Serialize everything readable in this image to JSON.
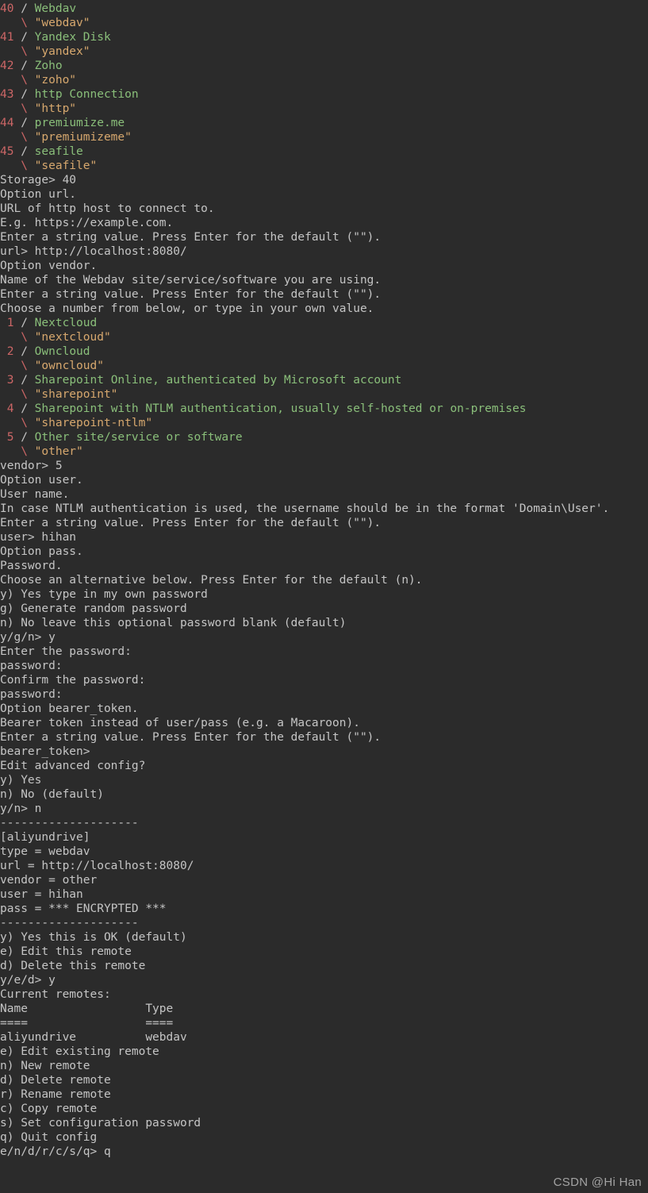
{
  "storage_options": [
    {
      "num": "40",
      "name": "Webdav",
      "code": "\"webdav\""
    },
    {
      "num": "41",
      "name": "Yandex Disk",
      "code": "\"yandex\""
    },
    {
      "num": "42",
      "name": "Zoho",
      "code": "\"zoho\""
    },
    {
      "num": "43",
      "name": "http Connection",
      "code": "\"http\""
    },
    {
      "num": "44",
      "name": "premiumize.me",
      "code": "\"premiumizeme\""
    },
    {
      "num": "45",
      "name": "seafile",
      "code": "\"seafile\""
    }
  ],
  "storage_prompt": "Storage> ",
  "storage_value": "40",
  "url_block": [
    "Option url.",
    "URL of http host to connect to.",
    "E.g. https://example.com.",
    "Enter a string value. Press Enter for the default (\"\")."
  ],
  "url_prompt": "url> ",
  "url_value": "http://localhost:8080/",
  "vendor_block": [
    "Option vendor.",
    "Name of the Webdav site/service/software you are using.",
    "Enter a string value. Press Enter for the default (\"\").",
    "Choose a number from below, or type in your own value."
  ],
  "vendor_options": [
    {
      "num": " 1",
      "name": "Nextcloud",
      "code": "\"nextcloud\""
    },
    {
      "num": " 2",
      "name": "Owncloud",
      "code": "\"owncloud\""
    },
    {
      "num": " 3",
      "name": "Sharepoint Online, authenticated by Microsoft account",
      "code": "\"sharepoint\""
    },
    {
      "num": " 4",
      "name": "Sharepoint with NTLM authentication, usually self-hosted or on-premises",
      "code": "\"sharepoint-ntlm\""
    },
    {
      "num": " 5",
      "name": "Other site/service or software",
      "code": "\"other\""
    }
  ],
  "vendor_prompt": "vendor> ",
  "vendor_value": "5",
  "user_block": [
    "Option user.",
    "User name.",
    "In case NTLM authentication is used, the username should be in the format 'Domain\\User'.",
    "Enter a string value. Press Enter for the default (\"\")."
  ],
  "user_prompt": "user> ",
  "user_value": "hihan",
  "pass_block": [
    "Option pass.",
    "Password.",
    "Choose an alternative below. Press Enter for the default (n).",
    "y) Yes type in my own password",
    "g) Generate random password",
    "n) No leave this optional password blank (default)"
  ],
  "pass_prompt": "y/g/n> ",
  "pass_value": "y",
  "password_lines": [
    "Enter the password:",
    "password:",
    "Confirm the password:",
    "password:"
  ],
  "bearer_block": [
    "Option bearer_token.",
    "Bearer token instead of user/pass (e.g. a Macaroon).",
    "Enter a string value. Press Enter for the default (\"\")."
  ],
  "bearer_prompt": "bearer_token>",
  "advanced_block": [
    "Edit advanced config?",
    "y) Yes",
    "n) No (default)"
  ],
  "advanced_prompt": "y/n> ",
  "advanced_value": "n",
  "sep": "--------------------",
  "config_header": "[aliyundrive]",
  "config_lines": [
    "type = webdav",
    "url = http://localhost:8080/",
    "vendor = other",
    "user = hihan",
    "pass = *** ENCRYPTED ***"
  ],
  "confirm_block": [
    "y) Yes this is OK (default)",
    "e) Edit this remote",
    "d) Delete this remote"
  ],
  "confirm_prompt": "y/e/d> ",
  "confirm_value": "y",
  "remotes_header": "Current remotes:",
  "remotes_cols": "Name                 Type",
  "remotes_sep": "====                 ====",
  "remotes_row": "aliyundrive          webdav",
  "menu_block": [
    "e) Edit existing remote",
    "n) New remote",
    "d) Delete remote",
    "r) Rename remote",
    "c) Copy remote",
    "s) Set configuration password",
    "q) Quit config"
  ],
  "menu_prompt": "e/n/d/r/c/s/q> ",
  "menu_value": "q",
  "watermark": "CSDN @Hi Han"
}
